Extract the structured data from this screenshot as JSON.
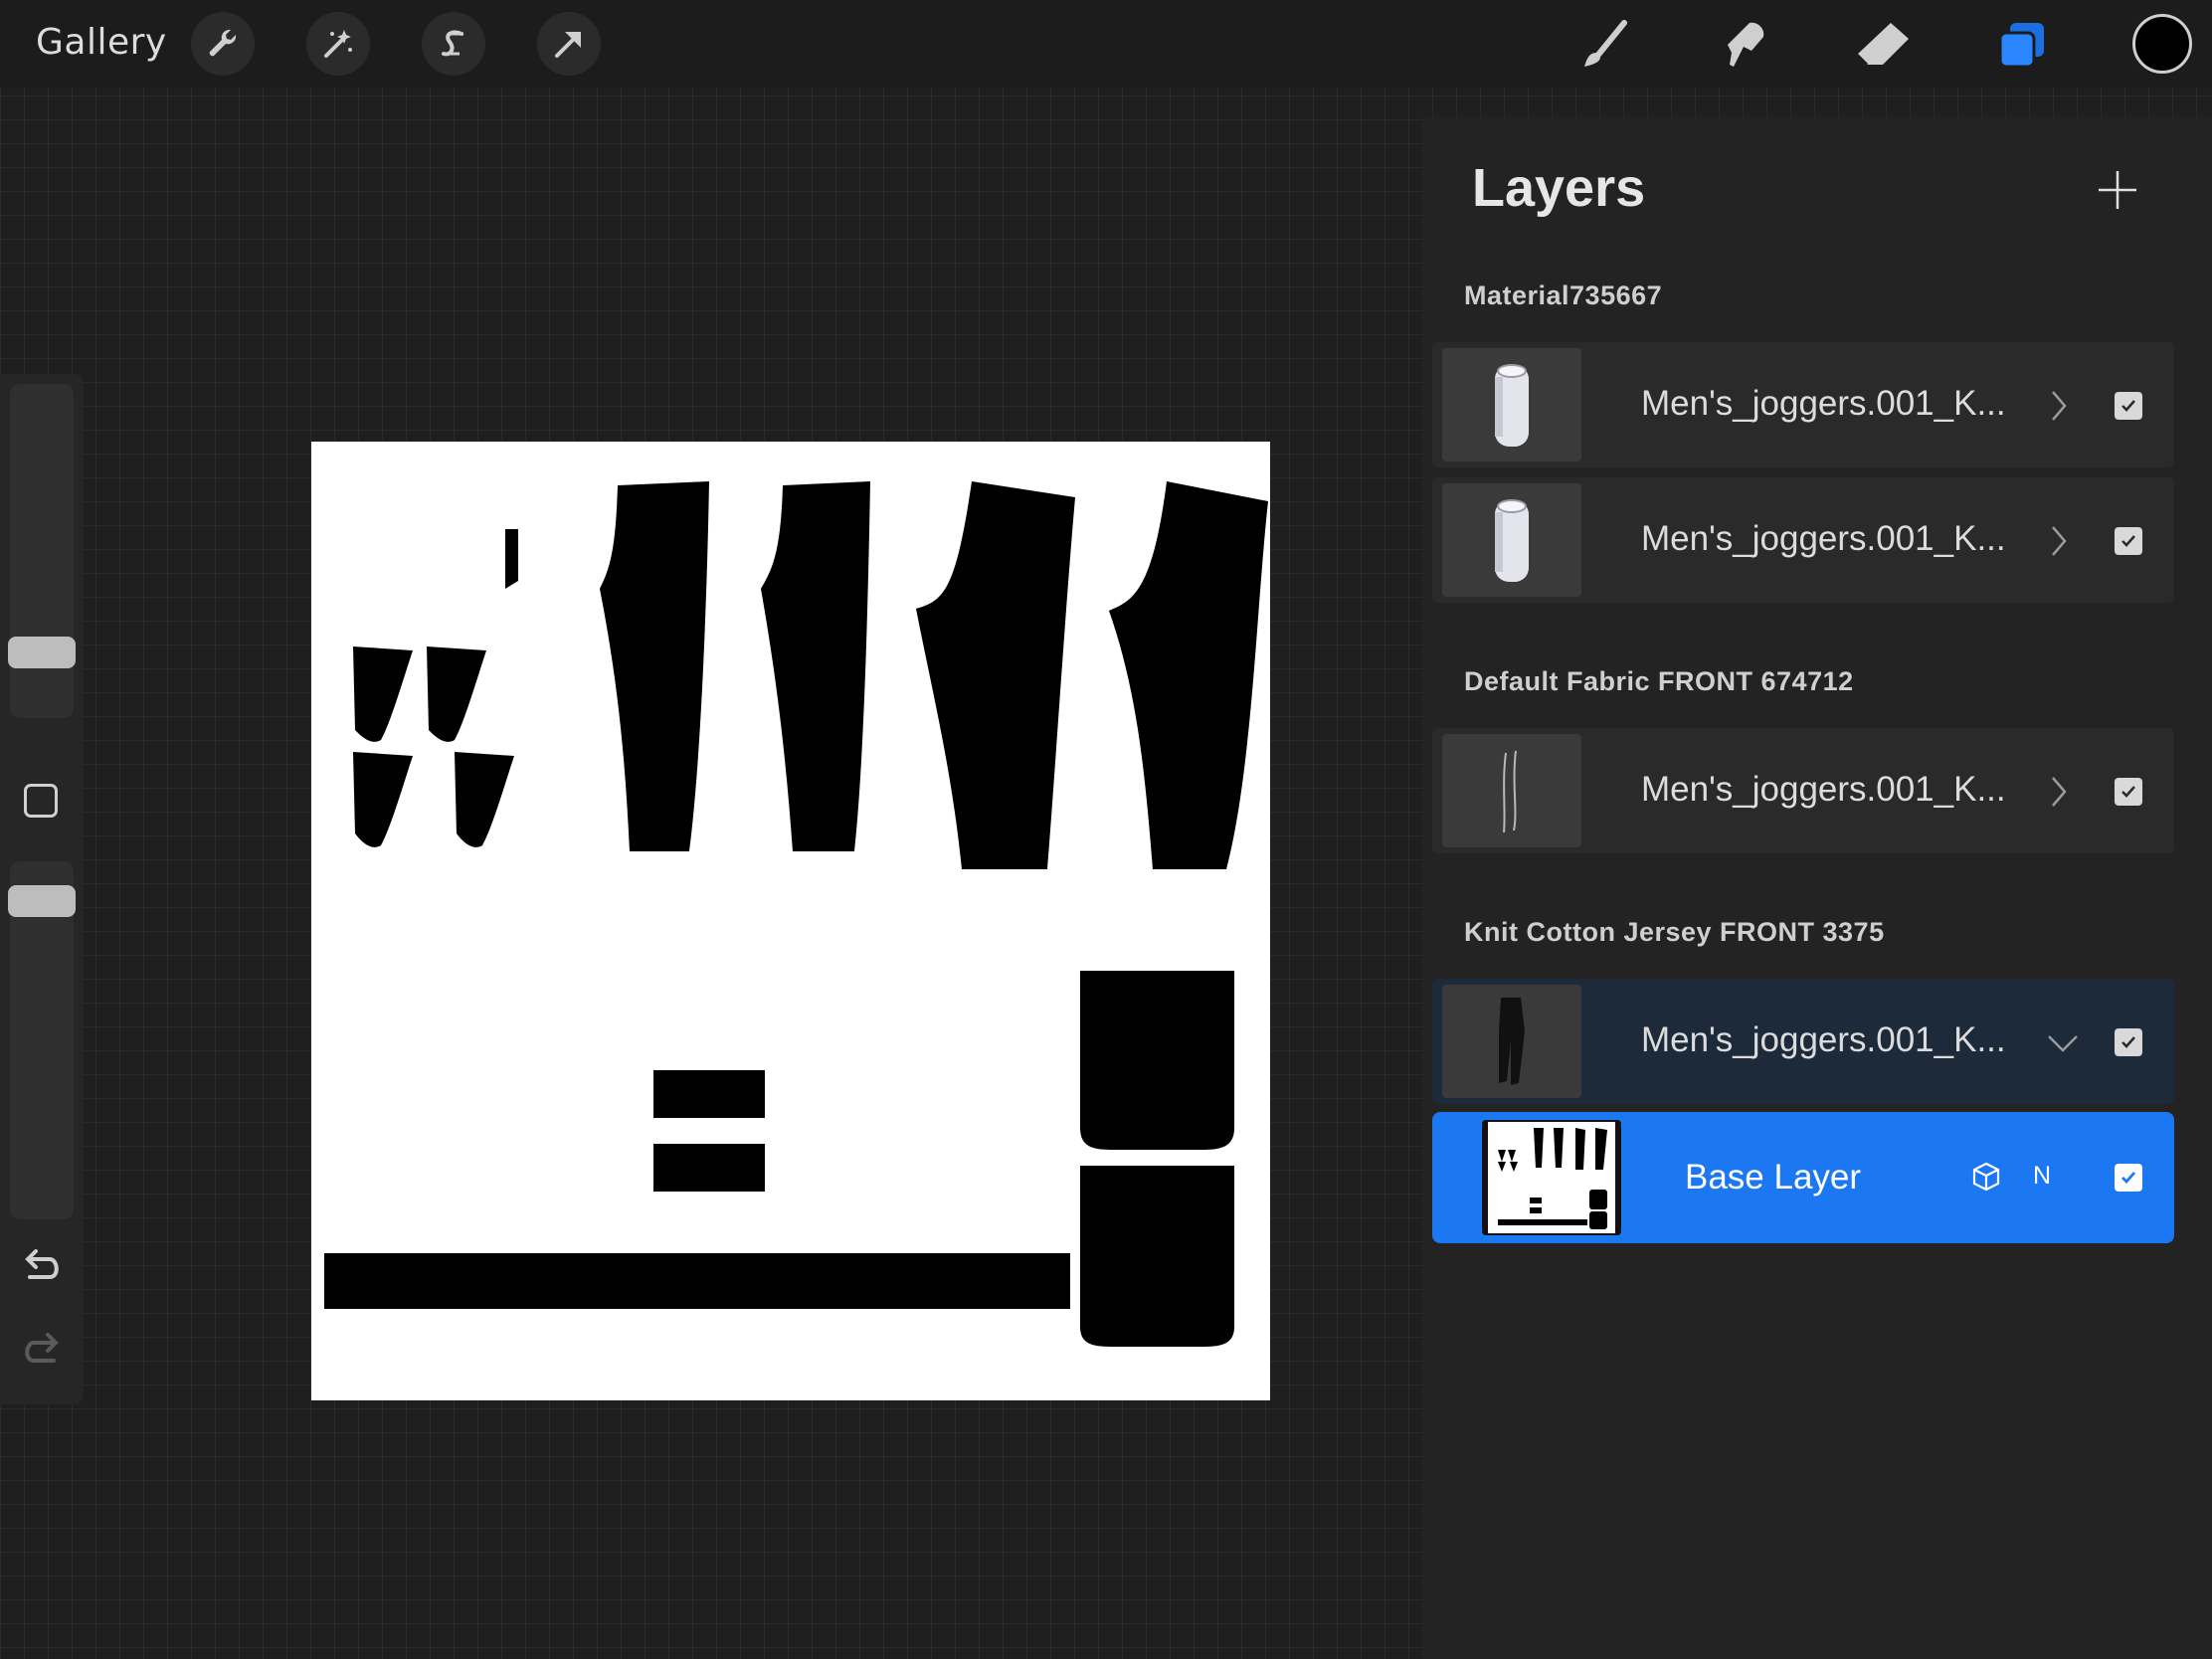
{
  "topbar": {
    "gallery_label": "Gallery",
    "left_tools": [
      "wrench-icon",
      "magic-wand-icon",
      "selection-s-icon",
      "transform-arrow-icon"
    ],
    "right_tools": [
      "brush-icon",
      "smudge-icon",
      "eraser-icon",
      "layers-icon"
    ],
    "active_tool": "layers-icon",
    "current_color": "#000000"
  },
  "sidebar": {
    "brush_size_level": 0.22,
    "opacity_level": 0.12,
    "icons": [
      "square-modify-icon",
      "undo-icon",
      "redo-icon"
    ]
  },
  "layers_panel": {
    "title": "Layers",
    "add_icon": "plus-icon",
    "groups": [
      {
        "label": "Material735667",
        "layers": [
          {
            "name": "Men's_joggers.001_K...",
            "visible": true,
            "thumb": "white-cylinder"
          },
          {
            "name": "Men's_joggers.001_K...",
            "visible": true,
            "thumb": "white-cylinder"
          }
        ]
      },
      {
        "label": "Default Fabric FRONT 674712",
        "layers": [
          {
            "name": "Men's_joggers.001_K...",
            "visible": true,
            "thumb": "thin-lines"
          }
        ]
      },
      {
        "label": "Knit Cotton Jersey FRONT 3375",
        "layers": [
          {
            "name": "Men's_joggers.001_K...",
            "visible": true,
            "thumb": "dark-joggers",
            "expanded": true
          }
        ]
      }
    ],
    "base_layer": {
      "name": "Base Layer",
      "blend_mode": "N",
      "visible": true,
      "selected": true,
      "accent": "#1b78f2"
    }
  }
}
